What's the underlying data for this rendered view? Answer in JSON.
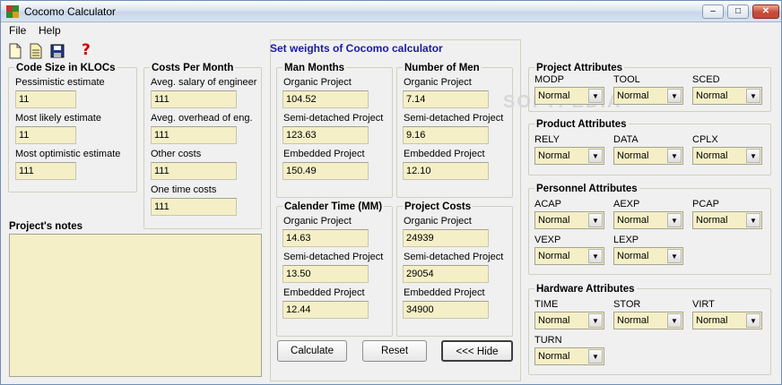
{
  "window": {
    "title": "Cocomo Calculator",
    "min": "–",
    "max": "□",
    "close": "✕"
  },
  "menu": [
    "File",
    "Help"
  ],
  "toolbar": {
    "icons": [
      "new-file-icon",
      "open-file-icon",
      "save-icon",
      "help-icon"
    ],
    "help_glyph": "?"
  },
  "code_size": {
    "title": "Code Size in KLOCs",
    "fields": [
      {
        "label": "Pessimistic estimate",
        "value": "11"
      },
      {
        "label": "Most likely estimate",
        "value": "11"
      },
      {
        "label": "Most optimistic estimate",
        "value": "111"
      }
    ]
  },
  "costs": {
    "title": "Costs Per Month",
    "fields": [
      {
        "label": "Aveg. salary of engineer",
        "value": "111"
      },
      {
        "label": "Aveg. overhead of eng.",
        "value": "111"
      },
      {
        "label": "Other costs",
        "value": "111"
      },
      {
        "label": "One time costs",
        "value": "111"
      }
    ]
  },
  "notes": {
    "title": "Project's notes",
    "value": ""
  },
  "weights": {
    "title": "Set weights of Cocomo calculator"
  },
  "man_months": {
    "title": "Man Months",
    "fields": [
      {
        "label": "Organic Project",
        "value": "104.52"
      },
      {
        "label": "Semi-detached Project",
        "value": "123.63"
      },
      {
        "label": "Embedded Project",
        "value": "150.49"
      }
    ]
  },
  "men": {
    "title": "Number of Men",
    "fields": [
      {
        "label": "Organic Project",
        "value": "7.14"
      },
      {
        "label": "Semi-detached Project",
        "value": "9.16"
      },
      {
        "label": "Embedded Project",
        "value": "12.10"
      }
    ]
  },
  "calendar": {
    "title": "Calender Time (MM)",
    "fields": [
      {
        "label": "Organic Project",
        "value": "14.63"
      },
      {
        "label": "Semi-detached Project",
        "value": "13.50"
      },
      {
        "label": "Embedded Project",
        "value": "12.44"
      }
    ]
  },
  "proj_costs": {
    "title": "Project Costs",
    "fields": [
      {
        "label": "Organic Project",
        "value": "24939"
      },
      {
        "label": "Semi-detached Project",
        "value": "29054"
      },
      {
        "label": "Embedded Project",
        "value": "34900"
      }
    ]
  },
  "buttons": {
    "calculate": "Calculate",
    "reset": "Reset",
    "hide": "<<< Hide"
  },
  "project_attrs": {
    "title": "Project Attributes",
    "items": [
      {
        "label": "MODP",
        "value": "Normal"
      },
      {
        "label": "TOOL",
        "value": "Normal"
      },
      {
        "label": "SCED",
        "value": "Normal"
      }
    ]
  },
  "product_attrs": {
    "title": "Product Attributes",
    "items": [
      {
        "label": "RELY",
        "value": "Normal"
      },
      {
        "label": "DATA",
        "value": "Normal"
      },
      {
        "label": "CPLX",
        "value": "Normal"
      }
    ]
  },
  "personnel_attrs": {
    "title": "Personnel Attributes",
    "items": [
      {
        "label": "ACAP",
        "value": "Normal"
      },
      {
        "label": "AEXP",
        "value": "Normal"
      },
      {
        "label": "PCAP",
        "value": "Normal"
      },
      {
        "label": "VEXP",
        "value": "Normal"
      },
      {
        "label": "LEXP",
        "value": "Normal"
      }
    ]
  },
  "hardware_attrs": {
    "title": "Hardware Attributes",
    "items": [
      {
        "label": "TIME",
        "value": "Normal"
      },
      {
        "label": "STOR",
        "value": "Normal"
      },
      {
        "label": "VIRT",
        "value": "Normal"
      },
      {
        "label": "TURN",
        "value": "Normal"
      }
    ]
  },
  "watermark": "SOFTPEDIA",
  "dropdown_arrow": "▼"
}
